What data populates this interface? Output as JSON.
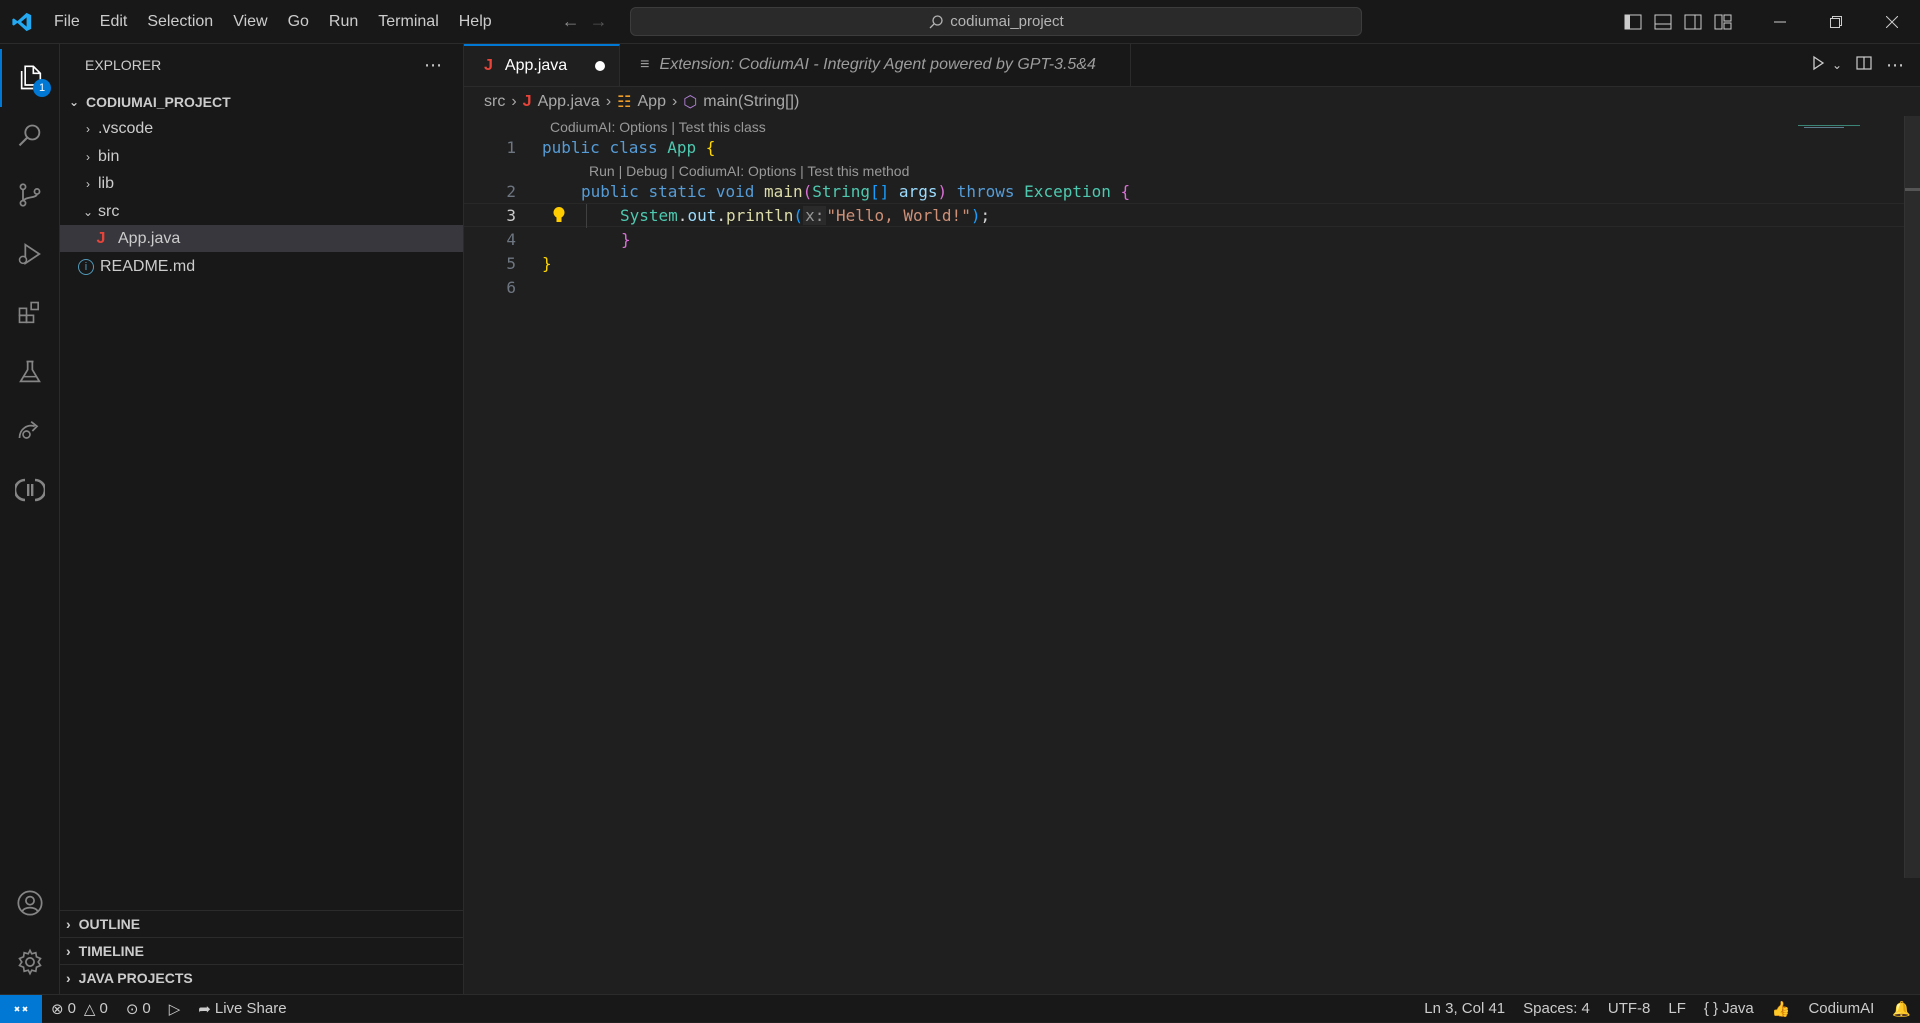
{
  "titlebar": {
    "menu": [
      "File",
      "Edit",
      "Selection",
      "View",
      "Go",
      "Run",
      "Terminal",
      "Help"
    ],
    "search_text": "codiumai_project"
  },
  "activity": {
    "explorer_badge": "1"
  },
  "sidebar": {
    "header": "EXPLORER",
    "project": "CODIUMAI_PROJECT",
    "items": [
      {
        "label": ".vscode"
      },
      {
        "label": "bin"
      },
      {
        "label": "lib"
      },
      {
        "label": "src"
      },
      {
        "label": "App.java"
      },
      {
        "label": "README.md"
      }
    ],
    "sections": [
      "OUTLINE",
      "TIMELINE",
      "JAVA PROJECTS"
    ]
  },
  "tabs": {
    "active": "App.java",
    "inactive": "Extension: CodiumAI - Integrity Agent powered by GPT-3.5&4"
  },
  "breadcrumb": [
    "src",
    "App.java",
    "App",
    "main(String[])"
  ],
  "code": {
    "lens1": "CodiumAI: Options | Test this class",
    "lens2": "Run | Debug | CodiumAI: Options | Test this method",
    "line_numbers": [
      "1",
      "2",
      "3",
      "4",
      "5",
      "6"
    ],
    "l1": {
      "kw1": "public",
      "kw2": "class",
      "cls": "App",
      "brace": "{"
    },
    "l2": {
      "kw1": "public",
      "kw2": "static",
      "kw3": "void",
      "fn": "main",
      "open": "(",
      "type": "String",
      "arr": "[]",
      "arg": "args",
      "close": ")",
      "kw4": "throws",
      "exc": "Exception",
      "brace": "{"
    },
    "l3": {
      "cls": "System",
      "dot1": ".",
      "var": "out",
      "dot2": ".",
      "fn": "println",
      "open": "(",
      "hint": "x:",
      "str": "\"Hello, World!\"",
      "close": ")",
      "semi": ";"
    },
    "l4": {
      "brace": "}"
    },
    "l5": {
      "brace": "}"
    }
  },
  "status": {
    "errors": "0",
    "warnings": "0",
    "ports": "0",
    "live_share": "Live Share",
    "position": "Ln 3, Col 41",
    "spaces": "Spaces: 4",
    "encoding": "UTF-8",
    "eol": "LF",
    "language": "Java",
    "codiumai": "CodiumAI"
  }
}
